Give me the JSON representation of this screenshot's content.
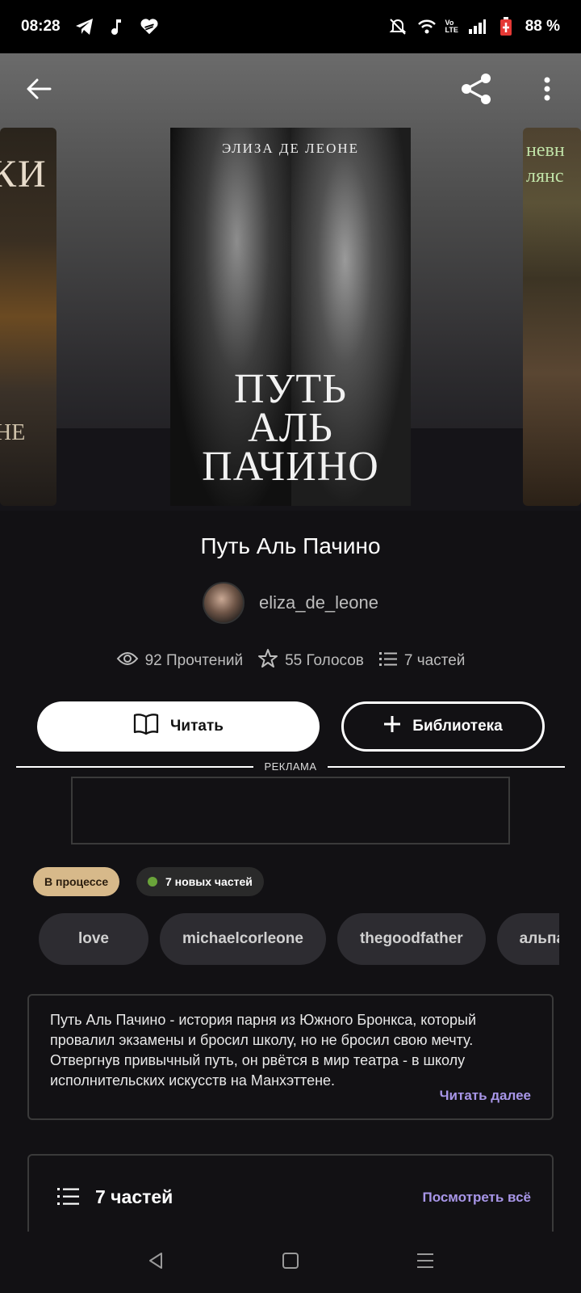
{
  "status_bar": {
    "time": "08:28",
    "battery": "88 %",
    "icons": [
      "telegram-icon",
      "music-note-icon",
      "heart-icon",
      "bell-off-icon",
      "wifi-icon",
      "volte-icon",
      "signal-icon",
      "battery-icon"
    ]
  },
  "toolbar": {
    "back_icon": "back-arrow-icon",
    "share_icon": "share-icon",
    "menu_icon": "more-vert-icon"
  },
  "covers": {
    "main": {
      "author": "ЭЛИЗА ДЕ ЛЕОНЕ",
      "title_line1": "ПУТЬ",
      "title_line2": "АЛЬ",
      "title_line3": "ПАЧИНО"
    },
    "left": {
      "text1": "КИ",
      "text2": "НЕ"
    },
    "right": {
      "text1": "невн",
      "text2": "лянс"
    }
  },
  "book": {
    "title": "Путь Аль Пачино",
    "author": "eliza_de_leone",
    "reads": "92 Прочтений",
    "votes": "55 Голосов",
    "parts": "7 частей"
  },
  "actions": {
    "read_label": "Читать",
    "library_label": "Библиотека"
  },
  "ad": {
    "label": "РЕКЛАМА"
  },
  "badges": {
    "status": "В процессе",
    "new_parts": "7 новых частей"
  },
  "tags": [
    "love",
    "michaelcorleone",
    "thegoodfather",
    "альпачино"
  ],
  "description": {
    "text": "Путь Аль Пачино - история парня из Южного Бронкса, который провалил экзамены и бросил школу, но не бросил  свою мечту. Отвергнув привычный путь, он рвётся в мир театра - в школу исполнительских искусств на Манхэттене.",
    "read_more": "Читать далее"
  },
  "parts_section": {
    "title": "7 частей",
    "see_all": "Посмотреть всё"
  },
  "colors": {
    "accent": "#a896e8",
    "badge_progress": "#d7b98a",
    "new_dot": "#6aa43a",
    "background": "#121114"
  }
}
